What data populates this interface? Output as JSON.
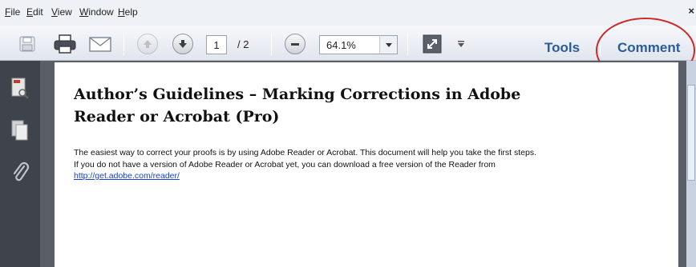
{
  "menu": {
    "items": [
      "File",
      "Edit",
      "View",
      "Window",
      "Help"
    ],
    "close_glyph": "×"
  },
  "toolbar": {
    "page_current": "1",
    "page_total": "/ 2",
    "zoom": "64.1%",
    "tools_label": "Tools",
    "comment_label": "Comment",
    "icons": [
      "save-icon",
      "print-icon",
      "email-icon",
      "previous-page-icon",
      "next-page-icon",
      "zoom-out-icon",
      "zoom-dropdown-icon",
      "fullscreen-icon",
      "toolbar-options-icon"
    ]
  },
  "leftpane": {
    "icons": [
      "page-thumbnails-icon",
      "pages-icon",
      "attachments-icon"
    ]
  },
  "document": {
    "title": "Author’s Guidelines – Marking Corrections in Adobe Reader or Acrobat (Pro)",
    "line1": "The easiest way to correct your proofs is by using Adobe Reader or Acrobat. This document will help you take the first steps.",
    "line2": "If you do not have a version of Adobe Reader or Acrobat yet, you can download a free version of the Reader from ",
    "link": "http://get.adobe.com/reader/"
  },
  "colors": {
    "accent": "#2a5b9a",
    "highlight_circle": "#cc2a2a",
    "left_pane": "#3f444c",
    "link": "#1a3fc8"
  }
}
